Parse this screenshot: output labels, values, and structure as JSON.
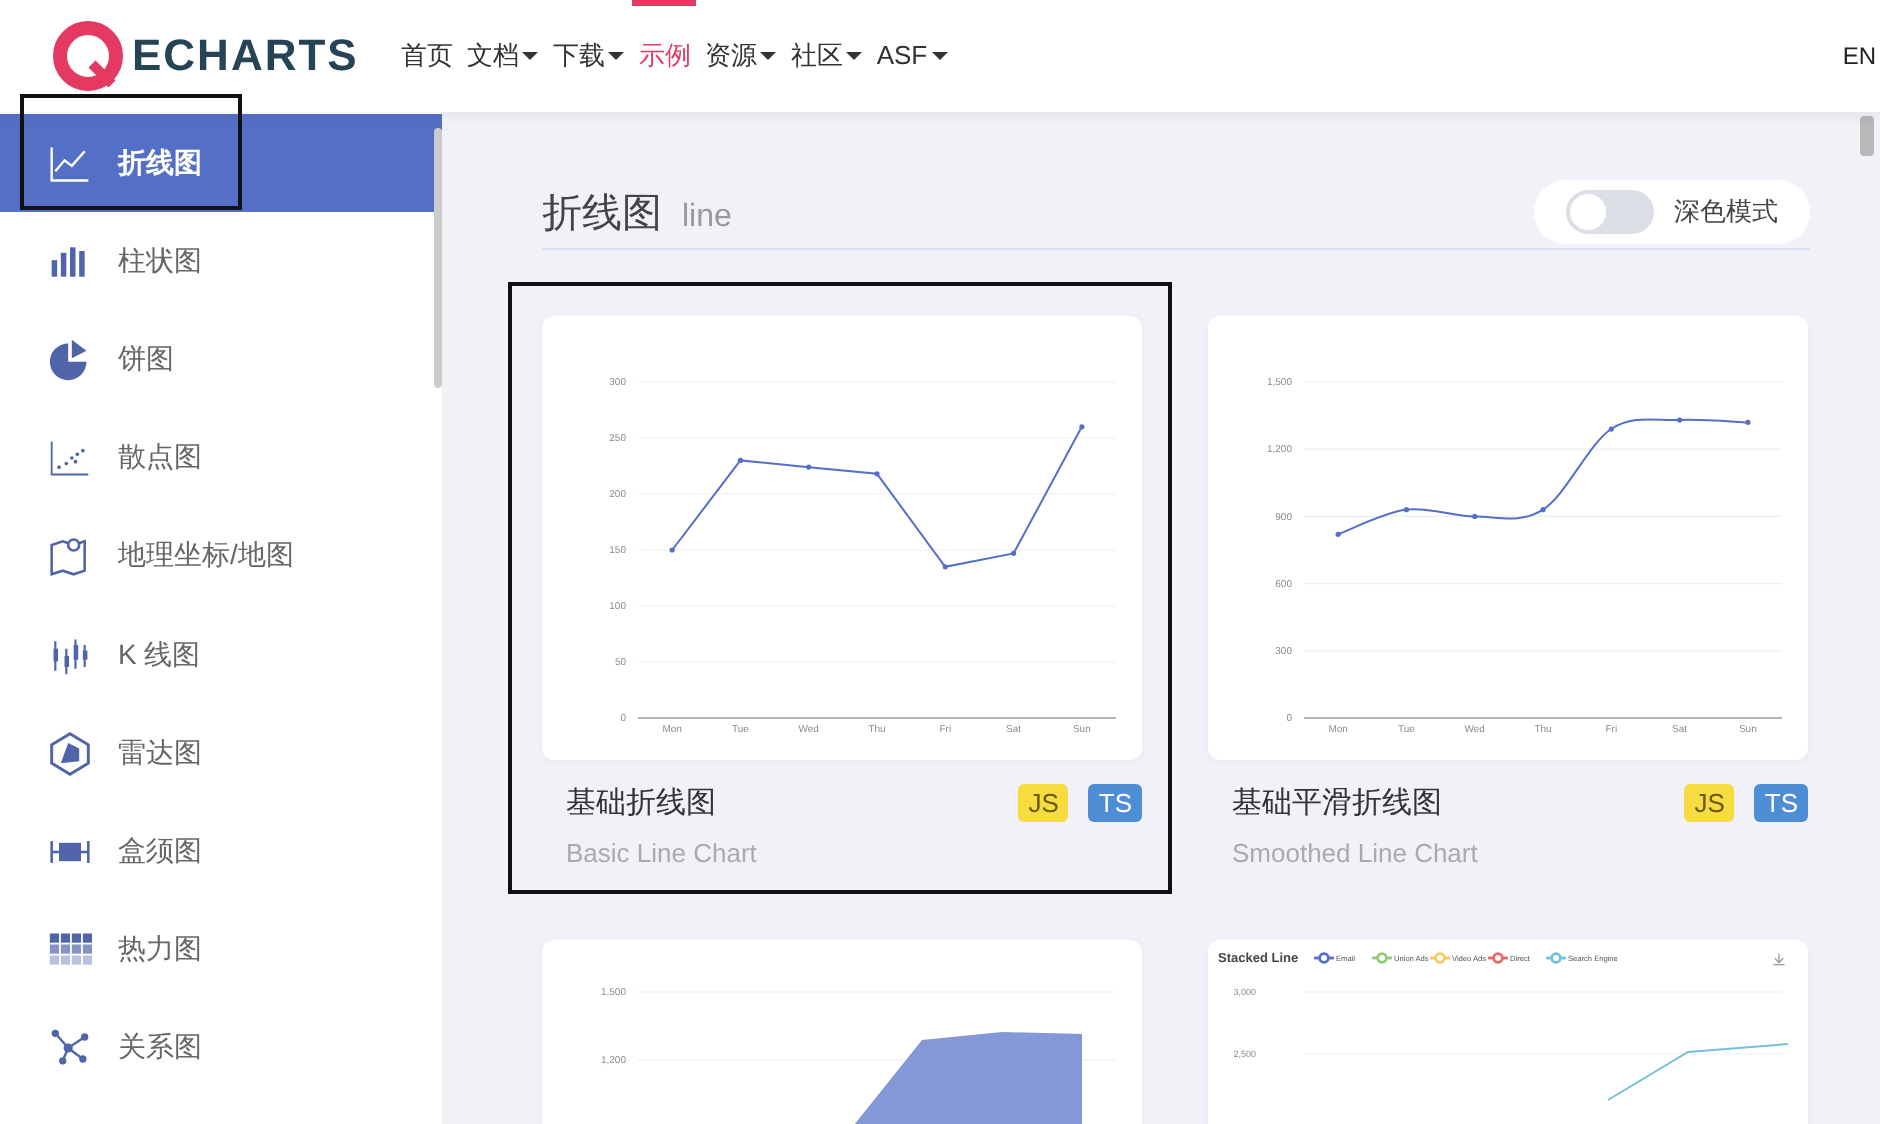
{
  "nav": {
    "logo": "ECHARTS",
    "items": [
      {
        "label": "首页",
        "dropdown": false,
        "selected": false
      },
      {
        "label": "文档",
        "dropdown": true,
        "selected": false
      },
      {
        "label": "下载",
        "dropdown": true,
        "selected": false
      },
      {
        "label": "示例",
        "dropdown": false,
        "selected": true
      },
      {
        "label": "资源",
        "dropdown": true,
        "selected": false
      },
      {
        "label": "社区",
        "dropdown": true,
        "selected": false
      },
      {
        "label": "ASF",
        "dropdown": true,
        "selected": false
      }
    ],
    "language": "EN"
  },
  "sidebar": {
    "items": [
      {
        "label": "折线图",
        "kind": "line",
        "selected": true,
        "annotated": true
      },
      {
        "label": "柱状图",
        "kind": "bar",
        "selected": false,
        "annotated": false
      },
      {
        "label": "饼图",
        "kind": "pie",
        "selected": false,
        "annotated": false
      },
      {
        "label": "散点图",
        "kind": "scatter",
        "selected": false,
        "annotated": false
      },
      {
        "label": "地理坐标/地图",
        "kind": "map",
        "selected": false,
        "annotated": false
      },
      {
        "label": "K 线图",
        "kind": "candlestick",
        "selected": false,
        "annotated": false
      },
      {
        "label": "雷达图",
        "kind": "radar",
        "selected": false,
        "annotated": false
      },
      {
        "label": "盒须图",
        "kind": "boxplot",
        "selected": false,
        "annotated": false
      },
      {
        "label": "热力图",
        "kind": "heatmap",
        "selected": false,
        "annotated": false
      },
      {
        "label": "关系图",
        "kind": "graph",
        "selected": false,
        "annotated": false
      }
    ]
  },
  "page": {
    "title": "折线图",
    "subtitle": "line",
    "dark_mode": {
      "label": "深色模式",
      "on": false
    }
  },
  "cards": [
    {
      "title": "基础折线图",
      "subtitle": "Basic Line Chart",
      "badges": [
        "JS",
        "TS"
      ],
      "annotated": true,
      "kind": "chart",
      "smooth": false,
      "chart_data": {
        "type": "line",
        "categories": [
          "Mon",
          "Tue",
          "Wed",
          "Thu",
          "Fri",
          "Sat",
          "Sun"
        ],
        "series": [
          {
            "color": "#5470c6",
            "values": [
              150,
              230,
              224,
              218,
              135,
              147,
              260
            ]
          }
        ],
        "ylim": [
          0,
          300
        ],
        "yticks": [
          0,
          50,
          100,
          150,
          200,
          250,
          300
        ],
        "grid": true
      }
    },
    {
      "title": "基础平滑折线图",
      "subtitle": "Smoothed Line Chart",
      "badges": [
        "JS",
        "TS"
      ],
      "annotated": false,
      "kind": "chart",
      "smooth": true,
      "chart_data": {
        "type": "line",
        "categories": [
          "Mon",
          "Tue",
          "Wed",
          "Thu",
          "Fri",
          "Sat",
          "Sun"
        ],
        "series": [
          {
            "color": "#5470c6",
            "values": [
              820,
              930,
              900,
              930,
              1290,
              1330,
              1320
            ]
          }
        ],
        "ylim": [
          0,
          1500
        ],
        "yticks": [
          {
            "value": 0,
            "label": "0"
          },
          {
            "value": 300,
            "label": "300"
          },
          {
            "value": 600,
            "label": "600"
          },
          {
            "value": 900,
            "label": "900"
          },
          {
            "value": 1200,
            "label": "1,200"
          },
          {
            "value": 1500,
            "label": "1,500"
          }
        ],
        "grid": true
      }
    },
    {
      "kind": "area-preview",
      "ticks": [
        "1,500",
        "1,200"
      ]
    },
    {
      "kind": "stacked-preview",
      "title": "Stacked Line",
      "ticks": [
        "3,000",
        "2,500"
      ],
      "legend": [
        {
          "label": "Email",
          "color": "#5470c6"
        },
        {
          "label": "Union Ads",
          "color": "#91cc75"
        },
        {
          "label": "Video Ads",
          "color": "#fac858"
        },
        {
          "label": "Direct",
          "color": "#ee6666"
        },
        {
          "label": "Search Engine",
          "color": "#73c0de"
        }
      ]
    }
  ]
}
